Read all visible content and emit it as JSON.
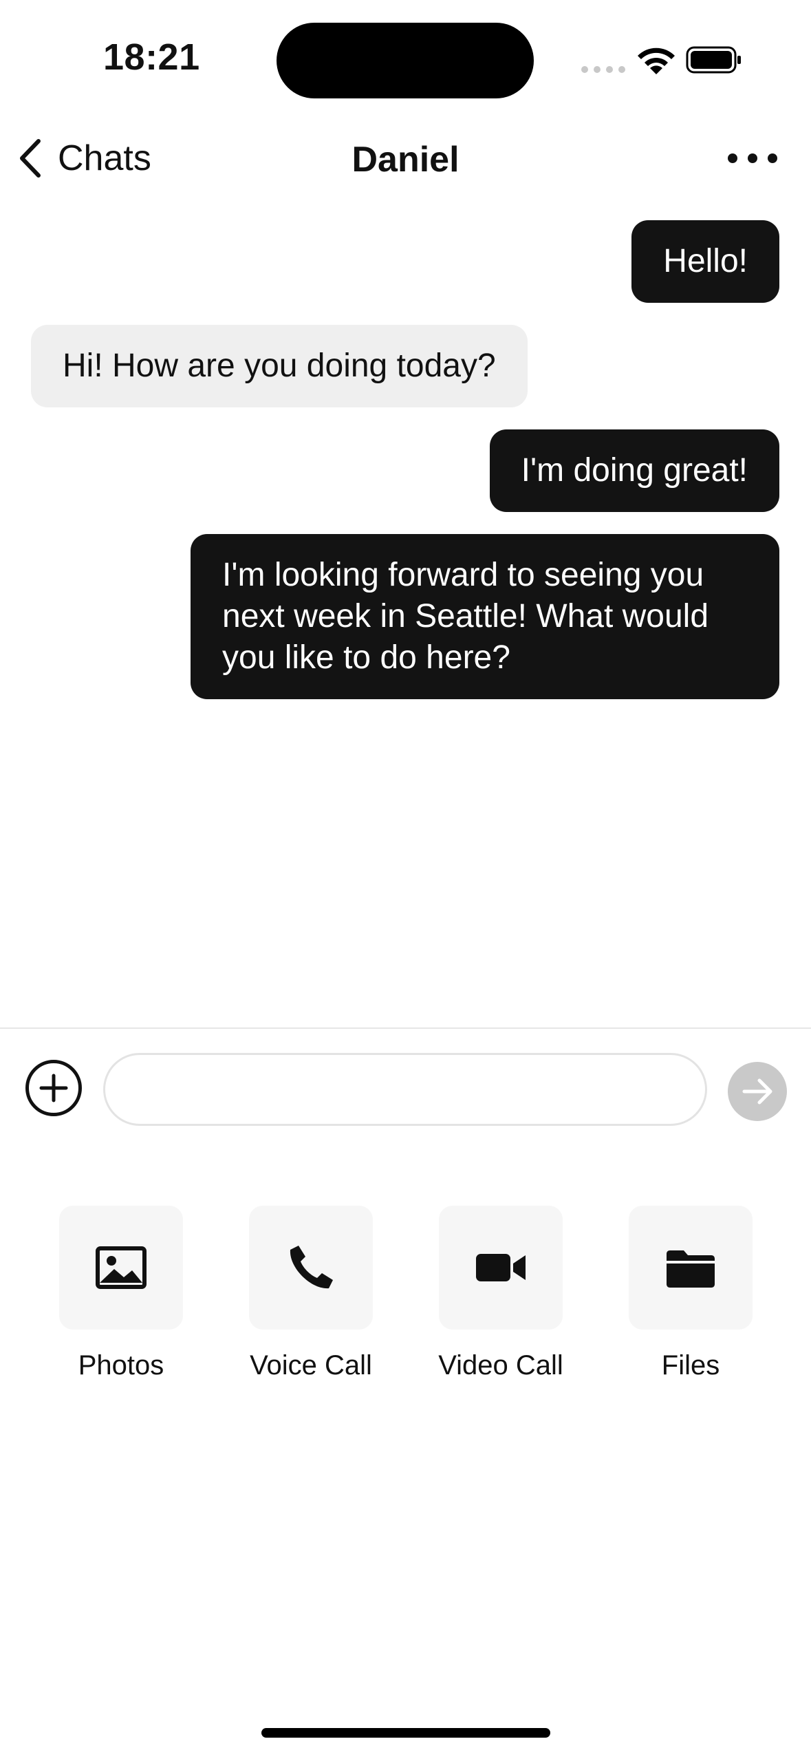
{
  "status_bar": {
    "time": "18:21",
    "icons": [
      "cellular-signal-icon",
      "wifi-icon",
      "battery-icon"
    ]
  },
  "nav": {
    "back_label": "Chats",
    "title": "Daniel",
    "back_icon": "chevron-left-icon",
    "more_icon": "ellipsis-icon"
  },
  "messages": [
    {
      "direction": "outgoing",
      "text": "Hello!"
    },
    {
      "direction": "incoming",
      "text": "Hi! How are you doing today?"
    },
    {
      "direction": "outgoing",
      "text": "I'm doing great!"
    },
    {
      "direction": "outgoing",
      "text": "I'm looking forward to seeing you next week in Seattle! What would you like to do here?"
    }
  ],
  "composer": {
    "input_value": "",
    "input_placeholder": "",
    "add_icon": "plus-circle-icon",
    "send_icon": "arrow-right-icon"
  },
  "attachments": [
    {
      "label": "Photos",
      "icon": "photo-icon"
    },
    {
      "label": "Voice Call",
      "icon": "phone-icon"
    },
    {
      "label": "Video Call",
      "icon": "video-camera-icon"
    },
    {
      "label": "Files",
      "icon": "folder-icon"
    }
  ],
  "colors": {
    "outgoing_bubble": "#131313",
    "incoming_bubble": "#efefef",
    "send_button_disabled": "#c9c9c9",
    "attachment_tile": "#f6f6f6"
  }
}
